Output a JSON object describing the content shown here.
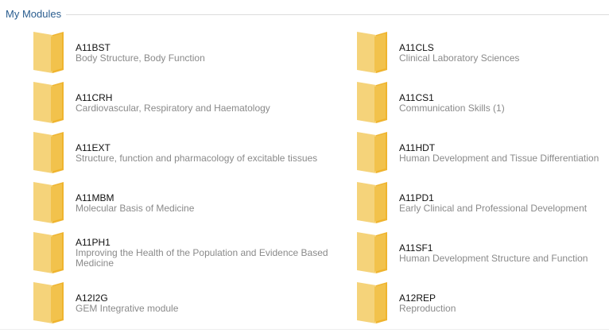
{
  "section": {
    "title": "My Modules"
  },
  "icons": {
    "folder": "folder-icon",
    "folder_back_color": "#f5d37a",
    "folder_front_color": "#efb42e"
  },
  "modules": [
    {
      "code": "A11BST",
      "title": "Body Structure, Body Function"
    },
    {
      "code": "A11CLS",
      "title": "Clinical Laboratory Sciences"
    },
    {
      "code": "A11CRH",
      "title": "Cardiovascular, Respiratory and Haematology"
    },
    {
      "code": "A11CS1",
      "title": "Communication Skills (1)"
    },
    {
      "code": "A11EXT",
      "title": "Structure, function and pharmacology of excitable tissues"
    },
    {
      "code": "A11HDT",
      "title": "Human Development and Tissue Differentiation"
    },
    {
      "code": "A11MBM",
      "title": "Molecular Basis of Medicine"
    },
    {
      "code": "A11PD1",
      "title": "Early Clinical and Professional Development"
    },
    {
      "code": "A11PH1",
      "title": "Improving the Health of the Population and Evidence Based Medicine"
    },
    {
      "code": "A11SF1",
      "title": "Human Development Structure and Function"
    },
    {
      "code": "A12I2G",
      "title": "GEM Integrative module"
    },
    {
      "code": "A12REP",
      "title": "Reproduction"
    }
  ]
}
